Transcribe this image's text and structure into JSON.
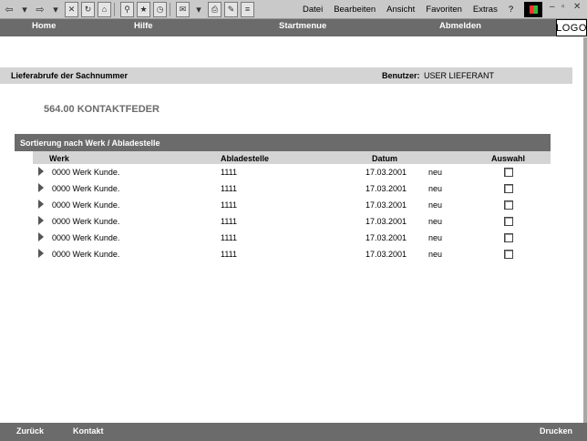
{
  "browser": {
    "menu": [
      "Datei",
      "Bearbeiten",
      "Ansicht",
      "Favoriten",
      "Extras",
      "?"
    ],
    "logo_icon": "windows-logo-icon"
  },
  "nav": {
    "home": "Home",
    "help": "Hilfe",
    "start_menu": "Startmenue",
    "logout": "Abmelden",
    "logo": "LOGO"
  },
  "header": {
    "title": "Lieferabrufe der Sachnummer",
    "user_label": "Benutzer:",
    "user_value": "USER LIEFERANT"
  },
  "part": {
    "title": "564.00 KONTAKTFEDER"
  },
  "section": {
    "title": "Sortierung nach Werk / Abladestelle"
  },
  "table": {
    "headers": {
      "werk": "Werk",
      "abladestelle": "Abladestelle",
      "datum": "Datum",
      "auswahl": "Auswahl"
    },
    "rows": [
      {
        "werk": "0000 Werk Kunde.",
        "abladestelle": "1111",
        "datum": "17.03.2001",
        "status": "neu",
        "selected": false
      },
      {
        "werk": "0000 Werk Kunde.",
        "abladestelle": "1111",
        "datum": "17.03.2001",
        "status": "neu",
        "selected": false
      },
      {
        "werk": "0000 Werk Kunde.",
        "abladestelle": "1111",
        "datum": "17.03.2001",
        "status": "neu",
        "selected": false
      },
      {
        "werk": "0000 Werk Kunde.",
        "abladestelle": "1111",
        "datum": "17.03.2001",
        "status": "neu",
        "selected": false
      },
      {
        "werk": "0000 Werk Kunde.",
        "abladestelle": "1111",
        "datum": "17.03.2001",
        "status": "neu",
        "selected": false
      },
      {
        "werk": "0000 Werk Kunde.",
        "abladestelle": "1111",
        "datum": "17.03.2001",
        "status": "neu",
        "selected": false
      }
    ]
  },
  "footer": {
    "back": "Zurück",
    "contact": "Kontakt",
    "print": "Drucken"
  },
  "colors": {
    "bar_dark": "#6b6b6b",
    "bar_light": "#d4d4d4",
    "part_title": "#6b6b6b"
  }
}
